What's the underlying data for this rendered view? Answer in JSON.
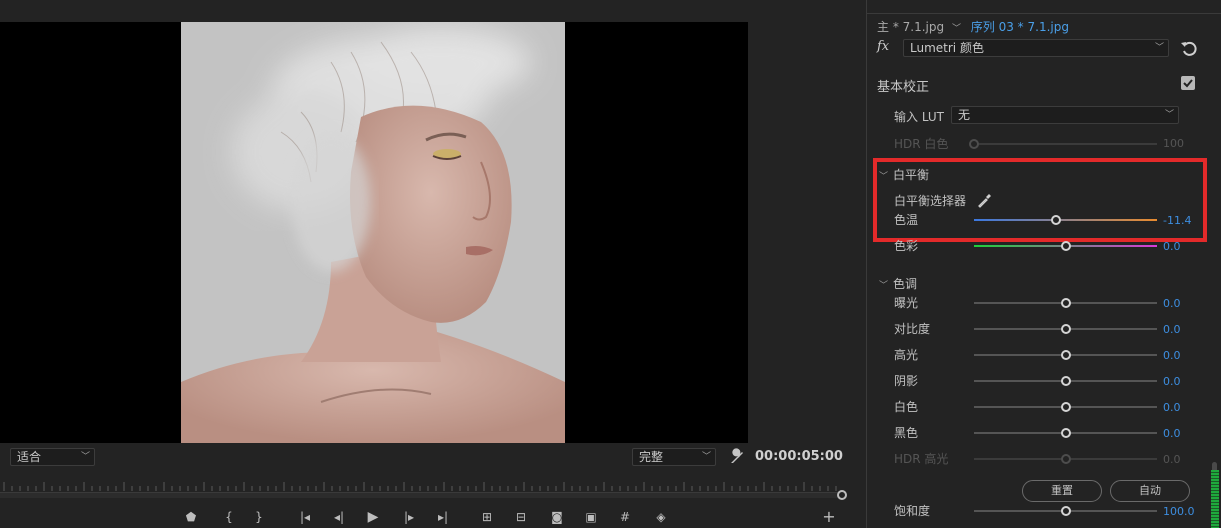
{
  "monitor": {
    "fit_value": "适合",
    "quality_value": "完整",
    "timecode": "00:00:05:00"
  },
  "panel": {
    "clip_master": "主 * 7.1.jpg",
    "clip_sequence": "序列 03 * 7.1.jpg",
    "fx_label": "fx",
    "effect_name": "Lumetri 颜色",
    "basic_section": "基本校正",
    "input_lut_label": "输入 LUT",
    "input_lut_value": "无",
    "hdr_white_label": "HDR 白色",
    "hdr_white_value": "100",
    "white_balance_title": "白平衡",
    "wb_selector_label": "白平衡选择器",
    "tone_title": "色调",
    "reset_button": "重置",
    "auto_button": "自动",
    "sliders": {
      "temperature": {
        "label": "色温",
        "value": "-11.4",
        "level": 0.45
      },
      "tint": {
        "label": "色彩",
        "value": "0.0",
        "level": 0.5
      },
      "exposure": {
        "label": "曝光",
        "value": "0.0",
        "level": 0.5
      },
      "contrast": {
        "label": "对比度",
        "value": "0.0",
        "level": 0.5
      },
      "highlights": {
        "label": "高光",
        "value": "0.0",
        "level": 0.5
      },
      "shadows": {
        "label": "阴影",
        "value": "0.0",
        "level": 0.5
      },
      "whites": {
        "label": "白色",
        "value": "0.0",
        "level": 0.5
      },
      "blacks": {
        "label": "黑色",
        "value": "0.0",
        "level": 0.5
      },
      "hdr_highlights": {
        "label": "HDR 高光",
        "value": "0.0",
        "level": 0.5
      },
      "saturation": {
        "label": "饱和度",
        "value": "100.0",
        "level": 0.5
      }
    }
  },
  "colors": {
    "accent_blue": "#3d8ee0",
    "highlight_red": "#e32a2a"
  }
}
